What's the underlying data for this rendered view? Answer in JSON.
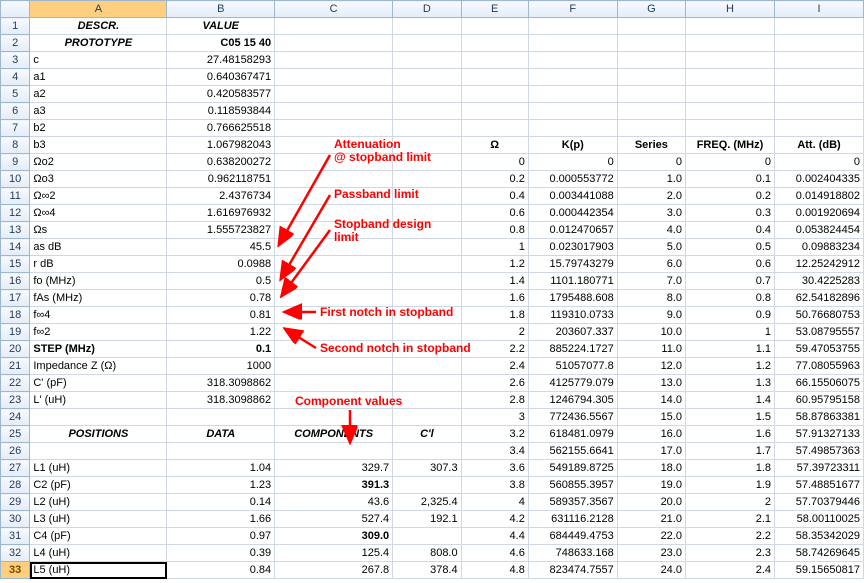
{
  "columns": [
    "A",
    "B",
    "C",
    "D",
    "E",
    "F",
    "G",
    "H",
    "I"
  ],
  "header_row": {
    "A": "DESCR.",
    "B": "VALUE",
    "F": "Ω",
    "G": "K(p)",
    "H": "Series",
    "I": "FREQ. (MHz)",
    "J": "Att. (dB)"
  },
  "rows": [
    {
      "n": 1,
      "A": "DESCR.",
      "B": "VALUE",
      "A_style": "center",
      "B_style": "center"
    },
    {
      "n": 2,
      "A": "PROTOTYPE",
      "B": "C05 15 40",
      "A_style": "center",
      "B_style": "bold"
    },
    {
      "n": 3,
      "A": "c",
      "B": "27.48158293"
    },
    {
      "n": 4,
      "A": "a1",
      "B": "0.640367471"
    },
    {
      "n": 5,
      "A": "a2",
      "B": "0.420583577"
    },
    {
      "n": 6,
      "A": "a3",
      "B": "0.118593844"
    },
    {
      "n": 7,
      "A": "b2",
      "B": "0.766625518"
    },
    {
      "n": 8,
      "A": "b3",
      "B": "1.067982043",
      "E": "Ω",
      "F": "K(p)",
      "G": "Series",
      "H": "FREQ. (MHz)",
      "I": "Att. (dB)",
      "E_style": "bold",
      "F_style": "bold",
      "G_style": "bold",
      "H_style": "bold",
      "I_style": "bold"
    },
    {
      "n": 9,
      "A": "Ωο2",
      "B": "0.638200272",
      "E": "0",
      "F": "0",
      "G": "0",
      "H": "0",
      "I": "0"
    },
    {
      "n": 10,
      "A": "Ωο3",
      "B": "0.962118751",
      "E": "0.2",
      "F": "0.000553772",
      "G": "1.0",
      "H": "0.1",
      "I": "0.002404335"
    },
    {
      "n": 11,
      "A": "Ω∞2",
      "B": "2.4376734",
      "E": "0.4",
      "F": "0.003441088",
      "G": "2.0",
      "H": "0.2",
      "I": "0.014918802"
    },
    {
      "n": 12,
      "A": "Ω∞4",
      "B": "1.616976932",
      "E": "0.6",
      "F": "0.000442354",
      "G": "3.0",
      "H": "0.3",
      "I": "0.001920694"
    },
    {
      "n": 13,
      "A": "Ωs",
      "B": "1.555723827",
      "E": "0.8",
      "F": "0.012470657",
      "G": "4.0",
      "H": "0.4",
      "I": "0.053824454"
    },
    {
      "n": 14,
      "A": "as dB",
      "B": "45.5",
      "E": "1",
      "F": "0.023017903",
      "G": "5.0",
      "H": "0.5",
      "I": "0.09883234"
    },
    {
      "n": 15,
      "A": "r dB",
      "B": "0.0988",
      "E": "1.2",
      "F": "15.79743279",
      "G": "6.0",
      "H": "0.6",
      "I": "12.25242912"
    },
    {
      "n": 16,
      "A": "fo (MHz)",
      "B": "0.5",
      "E": "1.4",
      "F": "1101.180771",
      "G": "7.0",
      "H": "0.7",
      "I": "30.4225283"
    },
    {
      "n": 17,
      "A": "fAs (MHz)",
      "B": "0.78",
      "E": "1.6",
      "F": "1795488.608",
      "G": "8.0",
      "H": "0.8",
      "I": "62.54182896"
    },
    {
      "n": 18,
      "A": "f∞4",
      "B": "0.81",
      "E": "1.8",
      "F": "119310.0733",
      "G": "9.0",
      "H": "0.9",
      "I": "50.76680753"
    },
    {
      "n": 19,
      "A": "f∞2",
      "B": "1.22",
      "E": "2",
      "F": "203607.337",
      "G": "10.0",
      "H": "1",
      "I": "53.08795557"
    },
    {
      "n": 20,
      "A": "STEP (MHz)",
      "B": "0.1",
      "A_style": "bold",
      "B_style": "bold",
      "E": "2.2",
      "F": "885224.1727",
      "G": "11.0",
      "H": "1.1",
      "I": "59.47053755"
    },
    {
      "n": 21,
      "A": "Impedance Z (Ω)",
      "B": "1000",
      "E": "2.4",
      "F": "51057077.8",
      "G": "12.0",
      "H": "1.2",
      "I": "77.08055963"
    },
    {
      "n": 22,
      "A": "C'   (pF)",
      "B": "318.3098862",
      "E": "2.6",
      "F": "4125779.079",
      "G": "13.0",
      "H": "1.3",
      "I": "66.15506075"
    },
    {
      "n": 23,
      "A": "L'   (uH)",
      "B": "318.3098862",
      "E": "2.8",
      "F": "1246794.305",
      "G": "14.0",
      "H": "1.4",
      "I": "60.95795158"
    },
    {
      "n": 24,
      "E": "3",
      "F": "772436.5567",
      "G": "15.0",
      "H": "1.5",
      "I": "58.87863381"
    },
    {
      "n": 25,
      "A": "POSITIONS",
      "B": "DATA",
      "C": "COMPONENTS",
      "D": "C'l",
      "A_style": "center",
      "B_style": "center",
      "C_style": "center",
      "D_style": "center",
      "E": "3.2",
      "F": "618481.0979",
      "G": "16.0",
      "H": "1.6",
      "I": "57.91327133"
    },
    {
      "n": 26,
      "E": "3.4",
      "F": "562155.6641",
      "G": "17.0",
      "H": "1.7",
      "I": "57.49857363"
    },
    {
      "n": 27,
      "A": "L1 (uH)",
      "B": "1.04",
      "C": "329.7",
      "D": "307.3",
      "E": "3.6",
      "F": "549189.8725",
      "G": "18.0",
      "H": "1.8",
      "I": "57.39723311"
    },
    {
      "n": 28,
      "A": "C2 (pF)",
      "B": "1.23",
      "C": "391.3",
      "C_style": "bold",
      "E": "3.8",
      "F": "560855.3957",
      "G": "19.0",
      "H": "1.9",
      "I": "57.48851677"
    },
    {
      "n": 29,
      "A": "L2 (uH)",
      "B": "0.14",
      "C": "43.6",
      "D": "2,325.4",
      "E": "4",
      "F": "589357.3567",
      "G": "20.0",
      "H": "2",
      "I": "57.70379446"
    },
    {
      "n": 30,
      "A": "L3 (uH)",
      "B": "1.66",
      "C": "527.4",
      "D": "192.1",
      "E": "4.2",
      "F": "631116.2128",
      "G": "21.0",
      "H": "2.1",
      "I": "58.00110025"
    },
    {
      "n": 31,
      "A": "C4 (pF)",
      "B": "0.97",
      "C": "309.0",
      "C_style": "bold",
      "E": "4.4",
      "F": "684449.4753",
      "G": "22.0",
      "H": "2.2",
      "I": "58.35342029"
    },
    {
      "n": 32,
      "A": "L4 (uH)",
      "B": "0.39",
      "C": "125.4",
      "D": "808.0",
      "E": "4.6",
      "F": "748633.168",
      "G": "23.0",
      "H": "2.3",
      "I": "58.74269645"
    },
    {
      "n": 33,
      "A": "L5 (uH)",
      "B": "0.84",
      "C": "267.8",
      "D": "378.4",
      "E": "4.8",
      "F": "823474.7557",
      "G": "24.0",
      "H": "2.4",
      "I": "59.15650817",
      "sel": true
    }
  ],
  "annotations": {
    "att_limit": "Attenuation\n@ stopband limit",
    "pass_limit": "Passband limit",
    "stop_design": "Stopband design\nlimit",
    "first_notch": "First notch in stopband",
    "second_notch": "Second notch in stopband",
    "comp_values": "Component values"
  },
  "chart_data": null
}
